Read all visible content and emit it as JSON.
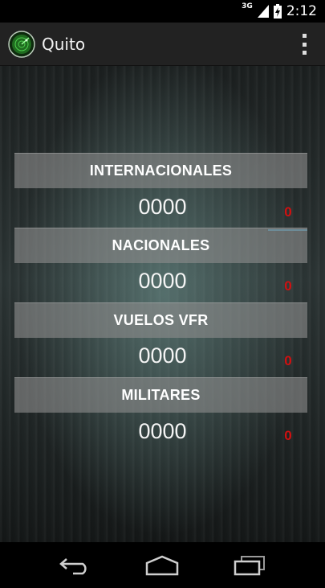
{
  "status_bar": {
    "network": "3G",
    "time": "2:12"
  },
  "action_bar": {
    "title": "Quito"
  },
  "sections": [
    {
      "header": "INTERNACIONALES",
      "value": "0000",
      "badge": "0"
    },
    {
      "header": "NACIONALES",
      "value": "0000",
      "badge": "0"
    },
    {
      "header": "VUELOS VFR",
      "value": "0000",
      "badge": "0"
    },
    {
      "header": "MILITARES",
      "value": "0000",
      "badge": "0"
    }
  ],
  "colors": {
    "badge": "#d21010",
    "header_bg": "#8c8c8c",
    "accent": "#3c8fb0"
  },
  "icons": [
    "radar-icon",
    "overflow-menu-icon",
    "signal-icon",
    "battery-icon",
    "back-icon",
    "home-icon",
    "recent-apps-icon"
  ]
}
